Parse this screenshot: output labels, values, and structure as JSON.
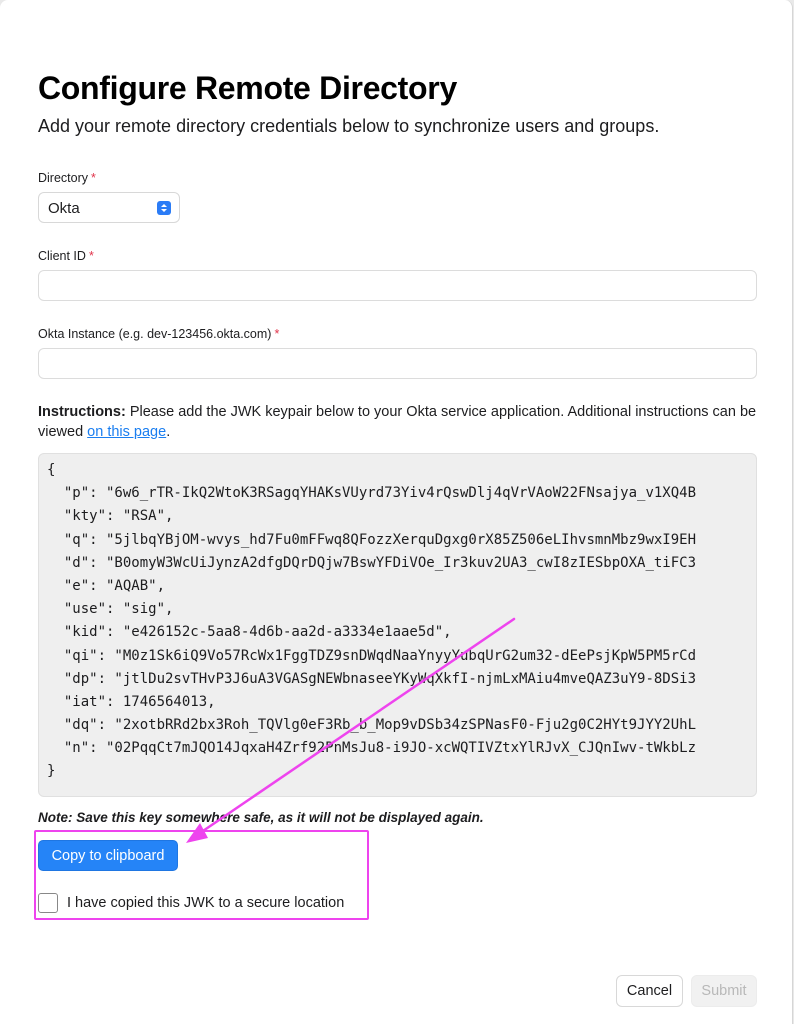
{
  "header": {
    "title": "Configure Remote Directory",
    "subtitle": "Add your remote directory credentials below to synchronize users and groups."
  },
  "form": {
    "directory": {
      "label": "Directory",
      "required_mark": "*",
      "selected": "Okta"
    },
    "client_id": {
      "label": "Client ID",
      "required_mark": "*",
      "value": ""
    },
    "okta_instance": {
      "label": "Okta Instance (e.g. dev-123456.okta.com)",
      "required_mark": "*",
      "value": ""
    }
  },
  "instructions": {
    "bold_prefix": "Instructions:",
    "text_before_link": " Please add the JWK keypair below to your Okta service application. Additional instructions can be viewed ",
    "link_text": "on this page",
    "text_after_link": "."
  },
  "jwk_lines": [
    "{",
    "  \"p\": \"6w6_rTR-IkQ2WtoK3RSagqYHAKsVUyrd73Yiv4rQswDlj4qVrVAoW22FNsajya_v1XQ4B",
    "  \"kty\": \"RSA\",",
    "  \"q\": \"5jlbqYBjOM-wvys_hd7Fu0mFFwq8QFozzXerquDgxg0rX85Z506eLIhvsmnMbz9wxI9EH",
    "  \"d\": \"B0omyW3WcUiJynzA2dfgDQrDQjw7BswYFDiVOe_Ir3kuv2UA3_cwI8zIESbpOXA_tiFC3",
    "  \"e\": \"AQAB\",",
    "  \"use\": \"sig\",",
    "  \"kid\": \"e426152c-5aa8-4d6b-aa2d-a3334e1aae5d\",",
    "  \"qi\": \"M0z1Sk6iQ9Vo57RcWx1FggTDZ9snDWqdNaaYnyyYubqUrG2um32-dEePsjKpW5PM5rCd",
    "  \"dp\": \"jtlDu2svTHvP3J6uA3VGASgNEWbnaseeYKyWqXkfI-njmLxMAiu4mveQAZ3uY9-8DSi3",
    "  \"iat\": 1746564013,",
    "  \"dq\": \"2xotbRRd2bx3Roh_TQVlg0eF3Rb_b_Mop9vDSb34zSPNasF0-Fju2g0C2HYt9JYY2UhL",
    "  \"n\": \"02PqqCt7mJQO14JqxaH4Zrf92PnMsJu8-i9JO-xcWQTIVZtxYlRJvX_CJQnIwv-tWkbLz",
    "}"
  ],
  "note": "Note: Save this key somewhere safe, as it will not be displayed again.",
  "copy_button": "Copy to clipboard",
  "confirm_checkbox": {
    "label": "I have copied this JWK to a secure location",
    "checked": false
  },
  "footer": {
    "cancel": "Cancel",
    "submit": "Submit"
  },
  "colors": {
    "primary": "#2584f7",
    "annotation": "#ee44ee",
    "required": "#e0334a",
    "link": "#1a7ef0"
  }
}
